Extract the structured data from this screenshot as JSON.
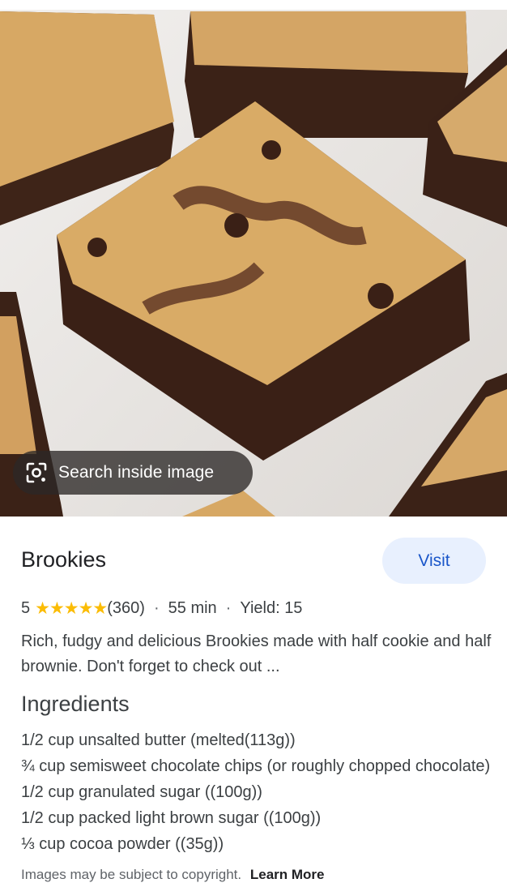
{
  "hero": {
    "lens_chip_label": "Search inside image"
  },
  "result": {
    "title": "Brookies",
    "visit_label": "Visit",
    "rating_value": "5",
    "stars": "★★★★★",
    "review_count": "(360)",
    "time": "55 min",
    "yield": "Yield: 15",
    "description": "Rich, fudgy and delicious Brookies made with half cookie and half brownie. Don't forget to check out ..."
  },
  "ingredients": {
    "title": "Ingredients",
    "items": [
      "1/2 cup unsalted butter (melted(113g))",
      "¾ cup semisweet chocolate chips (or roughly chopped chocolate)",
      "1/2 cup granulated sugar ((100g))",
      "1/2 cup packed light brown sugar ((100g))",
      "⅓ cup cocoa powder ((35g))"
    ]
  },
  "footer": {
    "copyright_text": "Images may be subject to copyright.",
    "learn_more": "Learn More"
  },
  "colors": {
    "visit_bg": "#e8f0fe",
    "visit_text": "#1a56c9",
    "star": "#fbbc04"
  }
}
